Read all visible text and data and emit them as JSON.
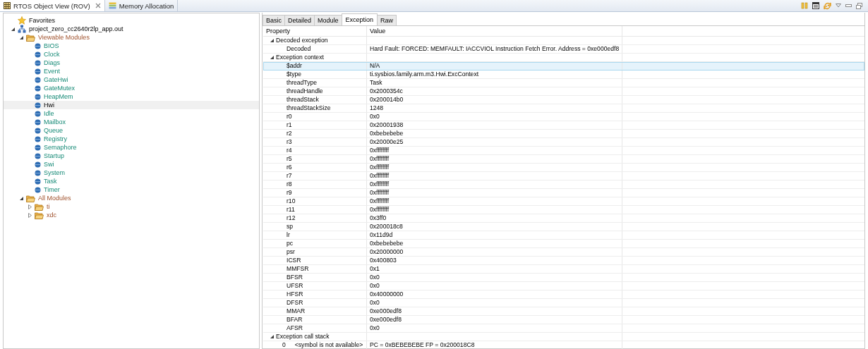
{
  "editor_tabs": [
    {
      "label": "RTOS Object View (ROV)",
      "selected": true,
      "kind": "grid",
      "closable": true
    },
    {
      "label": "Memory Allocation",
      "selected": false,
      "kind": "memory",
      "closable": false
    }
  ],
  "tree": [
    {
      "label": "Favorites",
      "kind": "star",
      "selected": false
    },
    {
      "label": "project_zero_cc2640r2lp_app.out",
      "kind": "project",
      "expanded": true,
      "selected": false,
      "children": [
        {
          "label": "Viewable Modules",
          "kind": "folder",
          "expanded": true,
          "selected": false,
          "children": [
            {
              "label": "BIOS",
              "kind": "module",
              "selected": false
            },
            {
              "label": "Clock",
              "kind": "module",
              "selected": false
            },
            {
              "label": "Diags",
              "kind": "module",
              "selected": false
            },
            {
              "label": "Event",
              "kind": "module",
              "selected": false
            },
            {
              "label": "GateHwi",
              "kind": "module",
              "selected": false
            },
            {
              "label": "GateMutex",
              "kind": "module",
              "selected": false
            },
            {
              "label": "HeapMem",
              "kind": "module",
              "selected": false
            },
            {
              "label": "Hwi",
              "kind": "module",
              "selected": true
            },
            {
              "label": "Idle",
              "kind": "module",
              "selected": false
            },
            {
              "label": "Mailbox",
              "kind": "module",
              "selected": false
            },
            {
              "label": "Queue",
              "kind": "module",
              "selected": false
            },
            {
              "label": "Registry",
              "kind": "module",
              "selected": false
            },
            {
              "label": "Semaphore",
              "kind": "module",
              "selected": false
            },
            {
              "label": "Startup",
              "kind": "module",
              "selected": false
            },
            {
              "label": "Swi",
              "kind": "module",
              "selected": false
            },
            {
              "label": "System",
              "kind": "module",
              "selected": false
            },
            {
              "label": "Task",
              "kind": "module",
              "selected": false
            },
            {
              "label": "Timer",
              "kind": "module",
              "selected": false
            }
          ]
        },
        {
          "label": "All Modules",
          "kind": "folder",
          "expanded": true,
          "selected": false,
          "children": [
            {
              "label": "ti",
              "kind": "package",
              "expanded": false,
              "selected": false
            },
            {
              "label": "xdc",
              "kind": "package",
              "expanded": false,
              "selected": false
            }
          ]
        }
      ]
    }
  ],
  "view_tabs": [
    {
      "label": "Basic",
      "selected": false
    },
    {
      "label": "Detailed",
      "selected": false
    },
    {
      "label": "Module",
      "selected": false
    },
    {
      "label": "Exception",
      "selected": true
    },
    {
      "label": "Raw",
      "selected": false
    }
  ],
  "table": {
    "columns": [
      "Property",
      "Value"
    ],
    "rows": [
      {
        "property": "Decoded exception",
        "expanded": true,
        "selected": false,
        "children": [
          {
            "property": "Decoded",
            "value": "Hard Fault: FORCED: MEMFAULT: IACCVIOL Instruction Fetch Error. Address = 0xe000edf8",
            "selected": false
          }
        ]
      },
      {
        "property": "Exception context",
        "expanded": true,
        "selected": false,
        "children": [
          {
            "property": "$addr",
            "value": "N/A",
            "selected": true
          },
          {
            "property": "$type",
            "value": "ti.sysbios.family.arm.m3.Hwi.ExcContext",
            "selected": false
          },
          {
            "property": "threadType",
            "value": "Task",
            "selected": false
          },
          {
            "property": "threadHandle",
            "value": "0x2000354c",
            "selected": false
          },
          {
            "property": "threadStack",
            "value": "0x200014b0",
            "selected": false
          },
          {
            "property": "threadStackSize",
            "value": "1248",
            "selected": false
          },
          {
            "property": "r0",
            "value": "0x0",
            "selected": false
          },
          {
            "property": "r1",
            "value": "0x20001938",
            "selected": false
          },
          {
            "property": "r2",
            "value": "0xbebebebe",
            "selected": false
          },
          {
            "property": "r3",
            "value": "0x20000e25",
            "selected": false
          },
          {
            "property": "r4",
            "value": "0xffffffff",
            "selected": false
          },
          {
            "property": "r5",
            "value": "0xffffffff",
            "selected": false
          },
          {
            "property": "r6",
            "value": "0xffffffff",
            "selected": false
          },
          {
            "property": "r7",
            "value": "0xffffffff",
            "selected": false
          },
          {
            "property": "r8",
            "value": "0xffffffff",
            "selected": false
          },
          {
            "property": "r9",
            "value": "0xffffffff",
            "selected": false
          },
          {
            "property": "r10",
            "value": "0xffffffff",
            "selected": false
          },
          {
            "property": "r11",
            "value": "0xffffffff",
            "selected": false
          },
          {
            "property": "r12",
            "value": "0x3ff0",
            "selected": false
          },
          {
            "property": "sp",
            "value": "0x200018c8",
            "selected": false
          },
          {
            "property": "lr",
            "value": "0x11d9d",
            "selected": false
          },
          {
            "property": "pc",
            "value": "0xbebebebe",
            "selected": false
          },
          {
            "property": "psr",
            "value": "0x20000000",
            "selected": false
          },
          {
            "property": "ICSR",
            "value": "0x400803",
            "selected": false
          },
          {
            "property": "MMFSR",
            "value": "0x1",
            "selected": false
          },
          {
            "property": "BFSR",
            "value": "0x0",
            "selected": false
          },
          {
            "property": "UFSR",
            "value": "0x0",
            "selected": false
          },
          {
            "property": "HFSR",
            "value": "0x40000000",
            "selected": false
          },
          {
            "property": "DFSR",
            "value": "0x0",
            "selected": false
          },
          {
            "property": "MMAR",
            "value": "0xe000edf8",
            "selected": false
          },
          {
            "property": "BFAR",
            "value": "0xe000edf8",
            "selected": false
          },
          {
            "property": "AFSR",
            "value": "0x0",
            "selected": false
          }
        ]
      },
      {
        "property": "Exception call stack",
        "expanded": true,
        "selected": false,
        "children": [
          {
            "index": "0",
            "property": "<symbol is not available>",
            "value": "PC = 0xBEBEBEBE FP = 0x200018C8",
            "selected": false
          }
        ]
      }
    ]
  }
}
